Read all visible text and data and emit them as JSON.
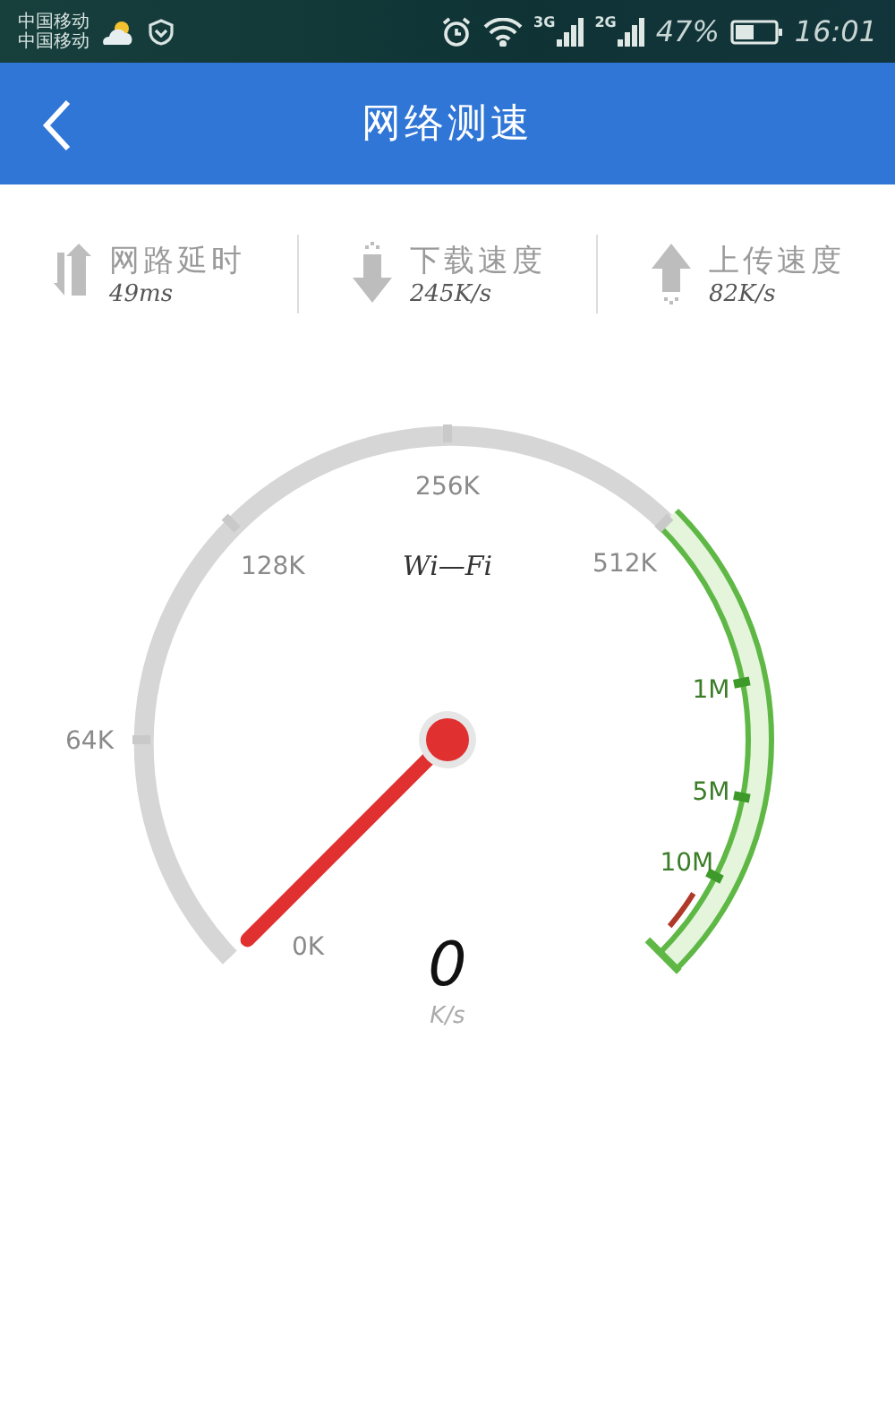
{
  "status_bar": {
    "carriers": [
      "中国移动",
      "中国移动"
    ],
    "network_labels": [
      "3G",
      "2G"
    ],
    "battery": "47%",
    "time": "16:01"
  },
  "header": {
    "title": "网络测速"
  },
  "stats": [
    {
      "kind": "latency",
      "label": "网路延时",
      "value": "49ms"
    },
    {
      "kind": "download",
      "label": "下载速度",
      "value": "245K/s"
    },
    {
      "kind": "upload",
      "label": "上传速度",
      "value": "82K/s"
    }
  ],
  "gauge": {
    "network": "Wi—Fi",
    "scale": [
      "0K",
      "64K",
      "128K",
      "256K",
      "512K",
      "1M",
      "5M",
      "10M"
    ],
    "reading": "0",
    "unit": "K/s"
  }
}
